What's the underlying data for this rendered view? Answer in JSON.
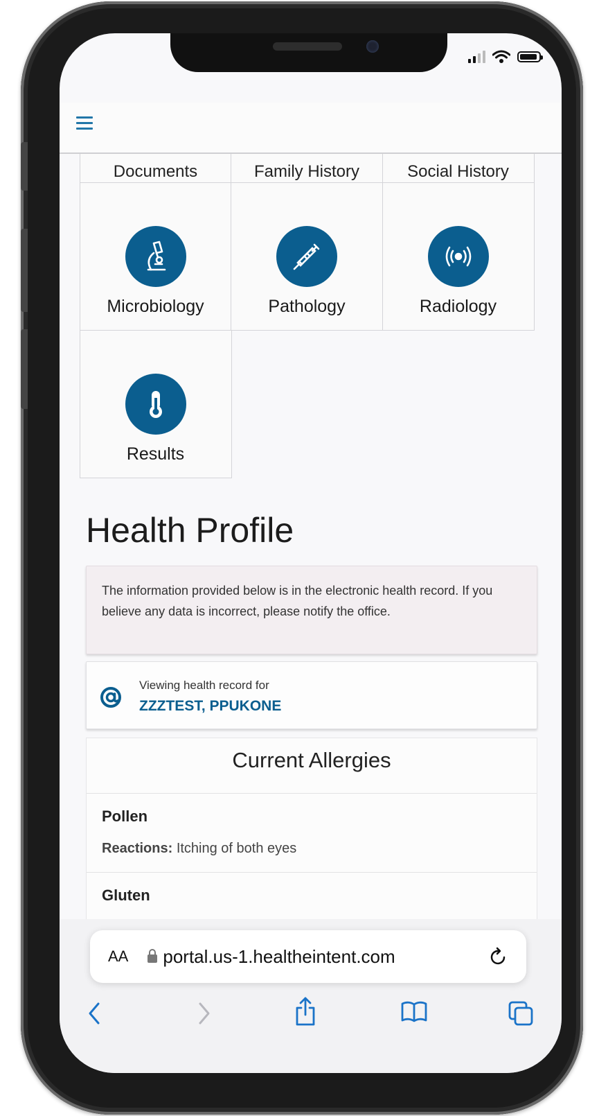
{
  "top_tiles_row": [
    "Documents",
    "Family History",
    "Social History"
  ],
  "tiles": [
    {
      "label": "Microbiology",
      "icon": "microscope-icon"
    },
    {
      "label": "Pathology",
      "icon": "syringe-icon"
    },
    {
      "label": "Radiology",
      "icon": "radio-waves-icon"
    },
    {
      "label": "Results",
      "icon": "thermometer-icon"
    }
  ],
  "page_title": "Health Profile",
  "notice_text": "The information provided below is in the electronic health record. If you believe any data is incorrect, please notify the office.",
  "viewing": {
    "label": "Viewing health record for",
    "patient_name": "ZZZTEST, PPUKONE"
  },
  "allergies": {
    "heading": "Current Allergies",
    "items": [
      {
        "name": "Pollen",
        "reactions_label": "Reactions:",
        "reactions": "Itching of both eyes"
      },
      {
        "name": "Gluten"
      }
    ]
  },
  "browser": {
    "text_size_label": "AA",
    "url": "portal.us-1.healtheintent.com"
  },
  "colors": {
    "accent": "#0b5e8f",
    "link": "#2176a8"
  }
}
